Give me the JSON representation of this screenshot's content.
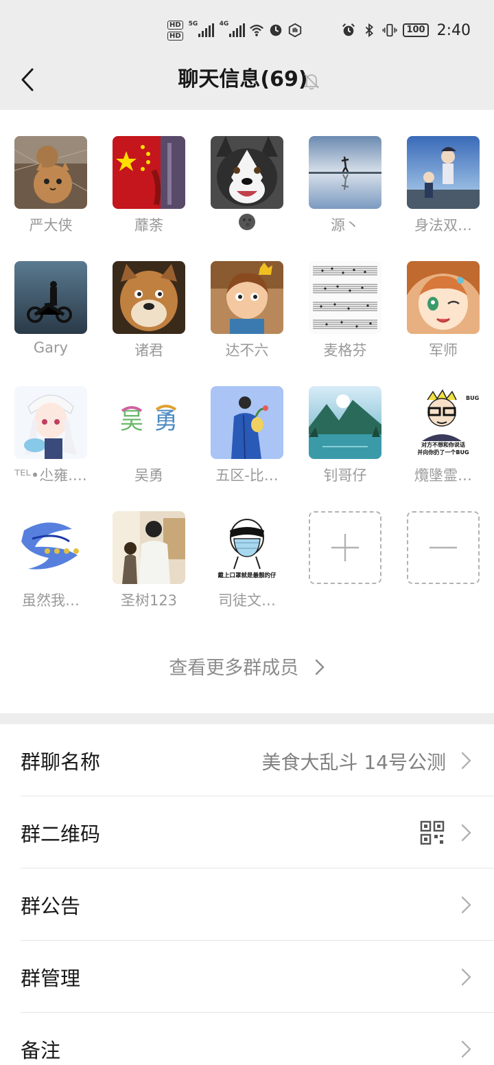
{
  "status_bar": {
    "hd1": "HD",
    "hd2": "HD",
    "net1": "5G",
    "net2": "4G",
    "battery": "100",
    "time": "2:40"
  },
  "nav": {
    "title": "聊天信息(69)"
  },
  "members": [
    {
      "name": "严大侠",
      "avatar": "cat-photo",
      "color": "#8a6a4a"
    },
    {
      "name": "蘼荼",
      "avatar": "china-flag",
      "color": "#c4161c"
    },
    {
      "name": "",
      "avatar": "husky-dog",
      "color": "#5a5a5a"
    },
    {
      "name": "源丶",
      "avatar": "sky-reflection",
      "color": "#a8b8cc"
    },
    {
      "name": "身法双…",
      "avatar": "anime-sky",
      "color": "#4a78b8"
    },
    {
      "name": "Gary",
      "avatar": "motorcycle-sea",
      "color": "#5a7080"
    },
    {
      "name": "诸君",
      "avatar": "doge",
      "color": "#9a6a3a"
    },
    {
      "name": "达不六",
      "avatar": "cartoon-boy",
      "color": "#d08a40"
    },
    {
      "name": "麦格芬",
      "avatar": "sheet-music",
      "color": "#ffffff"
    },
    {
      "name": "军师",
      "avatar": "anime-girl",
      "color": "#e0a060"
    },
    {
      "name": "ᵀᴱᴸ•尐雍.…",
      "avatar": "anime-white-hair",
      "color": "#e8eef8"
    },
    {
      "name": "吴勇",
      "avatar": "calligraphy",
      "color": "#ffffff"
    },
    {
      "name": "五区-比…",
      "avatar": "blue-coat-man",
      "color": "#a9c4f5"
    },
    {
      "name": "钊哥仔",
      "avatar": "lake-landscape",
      "color": "#4a8a9a"
    },
    {
      "name": "爦墬霊…",
      "avatar": "meme-glasses",
      "color": "#ffffff"
    },
    {
      "name": "虽然我…",
      "avatar": "blue-dragon-text",
      "color": "#ffffff"
    },
    {
      "name": "圣树123",
      "avatar": "couple-illustration",
      "color": "#c8b8a0"
    },
    {
      "name": "司徒文…",
      "avatar": "mask-meme",
      "color": "#ffffff"
    }
  ],
  "avatar_texts": {
    "meme_line1": "对方不想和你说话",
    "meme_line2": "并向你扔了一个BUG",
    "meme_tag": "BUG",
    "mask_caption": "戴上口罩就是最靓的仔"
  },
  "more_members": "查看更多群成员",
  "settings": [
    {
      "label": "群聊名称",
      "value": "美食大乱斗 14号公测"
    },
    {
      "label": "群二维码",
      "value": ""
    },
    {
      "label": "群公告",
      "value": ""
    },
    {
      "label": "群管理",
      "value": ""
    },
    {
      "label": "备注",
      "value": ""
    }
  ]
}
